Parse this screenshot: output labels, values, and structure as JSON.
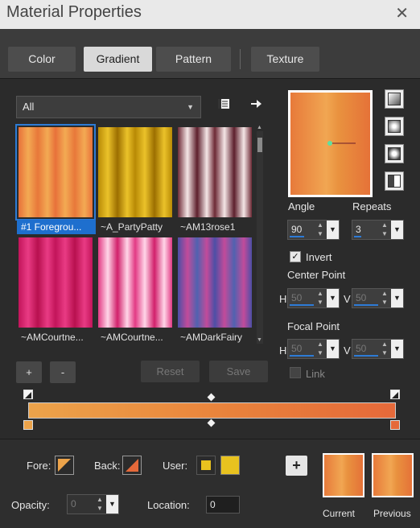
{
  "window": {
    "title": "Material Properties",
    "close_glyph": "✕"
  },
  "tabs": [
    {
      "label": "Color",
      "active": false
    },
    {
      "label": "Gradient",
      "active": true
    },
    {
      "label": "Pattern",
      "active": false
    },
    {
      "label": "Texture",
      "active": false
    }
  ],
  "library": {
    "category": "All",
    "dropdown_glyph": "▼",
    "tool_icons": [
      "library-options-icon",
      "export-arrow-icon"
    ],
    "swatches": [
      {
        "label": "#1 Foregrou...",
        "selected": true,
        "colors": [
          "#e8713a",
          "#f3aa53",
          "#e8783a"
        ]
      },
      {
        "label": "~A_PartyPatty",
        "selected": false,
        "colors": [
          "#b88a05",
          "#ebc22a",
          "#9c6f00"
        ]
      },
      {
        "label": "~AM13rose1",
        "selected": false,
        "colors": [
          "#6d2a36",
          "#f4e6e6",
          "#5d1f2c"
        ]
      },
      {
        "label": "~AMCourtne...",
        "selected": false,
        "colors": [
          "#c2145a",
          "#e93b84",
          "#b8104f"
        ]
      },
      {
        "label": "~AMCourtne...",
        "selected": false,
        "colors": [
          "#e23a84",
          "#ffd6e8",
          "#d1206b"
        ]
      },
      {
        "label": "~AMDarkFairy",
        "selected": false,
        "colors": [
          "#4c4fa6",
          "#c24b9a",
          "#5062b0"
        ]
      }
    ]
  },
  "actions": {
    "add": "+",
    "remove": "-",
    "reset": "Reset",
    "save": "Save"
  },
  "settings": {
    "angle_label": "Angle",
    "angle": "90",
    "repeats_label": "Repeats",
    "repeats": "3",
    "invert_label": "Invert",
    "invert": true,
    "center_point_label": "Center Point",
    "focal_point_label": "Focal Point",
    "h_label": "H",
    "v_label": "V",
    "center_h": "50",
    "center_v": "50",
    "focal_h": "50",
    "focal_v": "50",
    "link_label": "Link",
    "link": false,
    "gradient_types": [
      "linear-gradient-icon",
      "rectangular-gradient-icon",
      "sunburst-gradient-icon",
      "radial-gradient-icon"
    ]
  },
  "bottom": {
    "fore_label": "Fore:",
    "back_label": "Back:",
    "user_label": "User:",
    "opacity_label": "Opacity:",
    "opacity": "0",
    "location_label": "Location:",
    "location": "0",
    "add_glyph": "+",
    "current_label": "Current",
    "previous_label": "Previous",
    "user_color": "#e8c21f"
  },
  "colors": {
    "accent": "#1e6fce",
    "gradient_start": "#eca34a",
    "gradient_end": "#e5693a"
  }
}
